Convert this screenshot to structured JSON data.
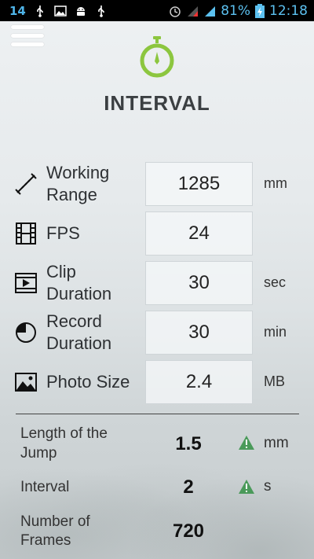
{
  "status_bar": {
    "notification_count": "14",
    "battery_percent": "81%",
    "time": "12:18",
    "icons": [
      "usb-icon",
      "image-icon",
      "android-icon",
      "usb-icon",
      "alarm-icon",
      "signal-no-data-icon",
      "signal-icon",
      "battery-charging-icon"
    ]
  },
  "header": {
    "title": "INTERVAL",
    "accent_color": "#8cc63f"
  },
  "inputs": [
    {
      "label_line1": "Working",
      "label_line2": "Range",
      "value": "1285",
      "unit": "mm",
      "icon": "measure-icon"
    },
    {
      "label_line1": "FPS",
      "label_line2": "",
      "value": "24",
      "unit": "",
      "icon": "film-icon"
    },
    {
      "label_line1": "Clip",
      "label_line2": "Duration",
      "value": "30",
      "unit": "sec",
      "icon": "video-icon"
    },
    {
      "label_line1": "Record",
      "label_line2": "Duration",
      "value": "30",
      "unit": "min",
      "icon": "clock-icon"
    },
    {
      "label_line1": "Photo Size",
      "label_line2": "",
      "value": "2.4",
      "unit": "MB",
      "icon": "photo-icon"
    }
  ],
  "results": [
    {
      "label_line1": "Length of the",
      "label_line2": "Jump",
      "value": "1.5",
      "unit": "mm",
      "warning": true
    },
    {
      "label_line1": "Interval",
      "label_line2": "",
      "value": "2",
      "unit": "s",
      "warning": true
    },
    {
      "label_line1": "Number of",
      "label_line2": "Frames",
      "value": "720",
      "unit": "",
      "warning": false
    }
  ],
  "colors": {
    "warning": "#4a9a5a",
    "status_blue": "#5cc1f0"
  }
}
